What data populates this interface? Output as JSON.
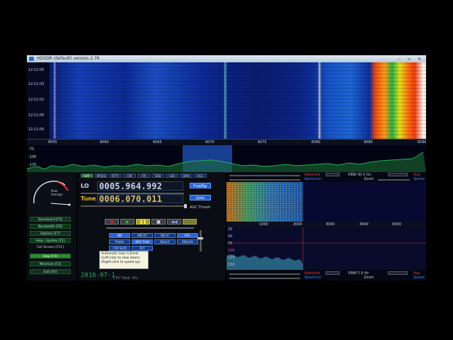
{
  "window": {
    "title": "HDSDR (default)  version 2.76"
  },
  "waterfall": {
    "time_labels": [
      "12:11:05",
      "12:11:03",
      "12:11:01",
      "12:11:00",
      "12:11:00"
    ],
    "freq_labels": [
      "6055",
      "6060",
      "6065",
      "6070",
      "6075",
      "6080",
      "6085",
      "6090"
    ]
  },
  "spectrum": {
    "y_labels": [
      "-75",
      "-100",
      "-125"
    ]
  },
  "smeter": {
    "label": "Peak\nAverage"
  },
  "left_buttons": [
    {
      "label": "Soundcard [F5]"
    },
    {
      "label": "Bandwidth [F6]"
    },
    {
      "label": "Options [F7]"
    },
    {
      "label": "Help / Update [F1]"
    },
    {
      "label": "Full Screen [F11]"
    },
    {
      "label": "Stop [F2]",
      "active": true
    },
    {
      "label": "Minimize [F3]"
    },
    {
      "label": "Exit [F4]"
    }
  ],
  "top_buttons": [
    "EXT",
    "MODE",
    "RTTY",
    "CW",
    "FM",
    "DSB",
    "LSB",
    "DRM",
    "AGC"
  ],
  "lo": {
    "label": "LO",
    "value": "0005.964.992"
  },
  "tune": {
    "label": "Tune",
    "value": "0006.070.011"
  },
  "buttons": {
    "freq_mgr": "FreqMgr",
    "goto": "Goto"
  },
  "agc_label": "AGC Thresh.",
  "mode_rows": [
    [
      "NB",
      "NB RF",
      "NR IF",
      "AFC"
    ],
    [
      "Flatte",
      "AGC Fast",
      "Notch",
      "ANotch"
    ],
    [
      "CW Shift",
      "RIT",
      "",
      ""
    ]
  ],
  "tooltip": {
    "line1": "Automatic Gain Control",
    "line2": "(Left-click to slow down)",
    "line3": "(Right-click to speed up)"
  },
  "datetime": "2016-07-1",
  "cpu": "CPU Total:  9%",
  "zoom_panel": {
    "top": {
      "waterfall": "Waterfall",
      "spectrum": "Spectrum",
      "rbw": "RBW",
      "rbw_value": "30.5 Hz",
      "zoom": "Zoom",
      "avg": "Avg",
      "speed": "Speed"
    },
    "axis_labels": [
      "1000",
      "2000",
      "3000",
      "4000",
      "5000"
    ],
    "y_labels": [
      "25",
      "50",
      "75",
      "100",
      "125",
      "150"
    ],
    "bottom": {
      "waterfall": "Waterfall",
      "spectrum": "Spectrum",
      "rbw": "RBW",
      "rbw_value": "5.9 Hz",
      "zoom": "Zoom",
      "avg": "Avg",
      "speed": "Speed"
    }
  },
  "colors": {
    "accent_blue": "#1e5fd0",
    "green": "#2c8a2c",
    "tune_yellow": "#e8c020"
  }
}
